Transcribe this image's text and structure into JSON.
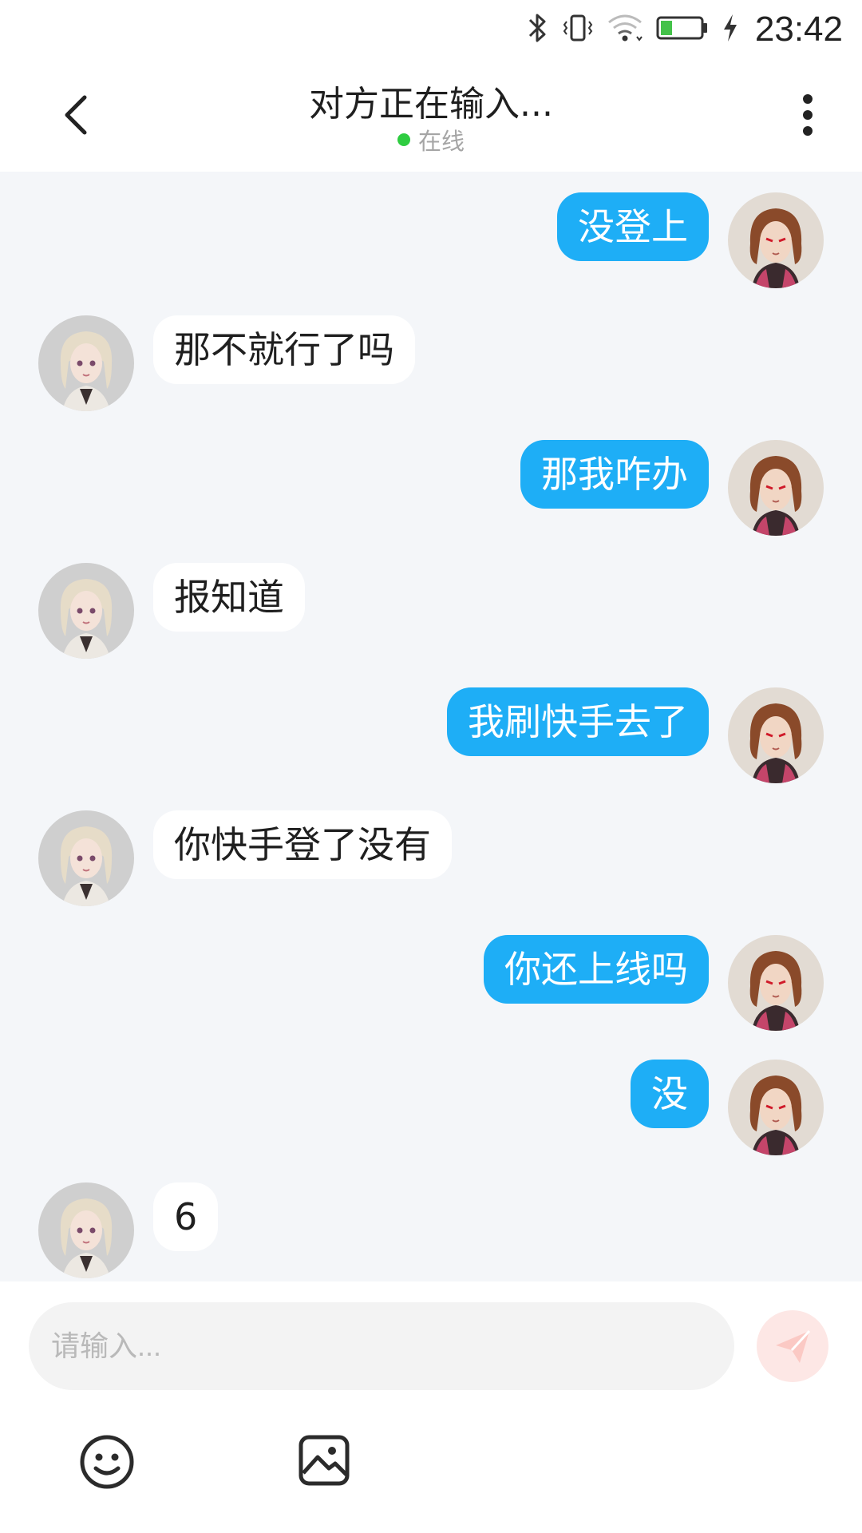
{
  "status_bar": {
    "time": "23:42",
    "icons": [
      "bluetooth-icon",
      "vibrate-icon",
      "wifi-icon",
      "battery-icon",
      "charging-icon"
    ],
    "battery_color": "#44c24a"
  },
  "header": {
    "title": "对方正在输入...",
    "status_text": "在线",
    "status_color": "#2ecc40",
    "back_icon": "chevron-left-icon",
    "menu_icon": "more-vertical-icon"
  },
  "colors": {
    "outgoing_bubble": "#1eaef6",
    "incoming_bubble": "#ffffff",
    "chat_background": "#f4f6f9"
  },
  "messages": [
    {
      "side": "out",
      "text": "没登上"
    },
    {
      "side": "in",
      "text": "那不就行了吗"
    },
    {
      "side": "out",
      "text": "那我咋办"
    },
    {
      "side": "in",
      "text": "报知道"
    },
    {
      "side": "out",
      "text": "我刷快手去了"
    },
    {
      "side": "in",
      "text": "你快手登了没有"
    },
    {
      "side": "out",
      "text": "你还上线吗"
    },
    {
      "side": "out",
      "text": "没"
    },
    {
      "side": "in",
      "text": "6"
    }
  ],
  "composer": {
    "placeholder": "请输入...",
    "send_icon": "send-icon",
    "emoji_icon": "emoji-icon",
    "image_icon": "image-icon"
  }
}
